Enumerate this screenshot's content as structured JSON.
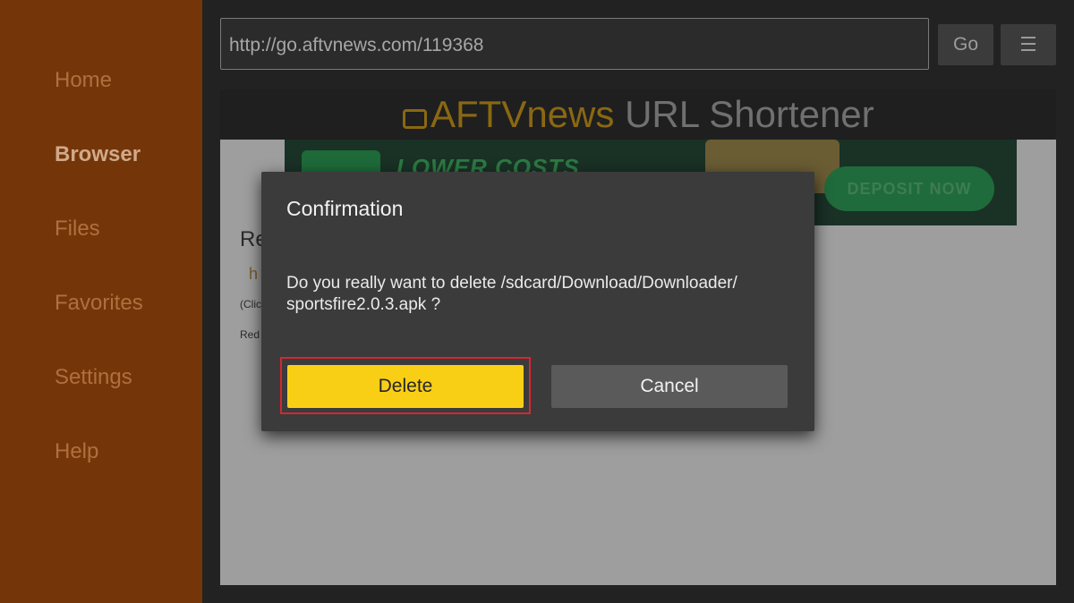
{
  "sidebar": {
    "items": [
      {
        "label": "Home"
      },
      {
        "label": "Browser"
      },
      {
        "label": "Files"
      },
      {
        "label": "Favorites"
      },
      {
        "label": "Settings"
      },
      {
        "label": "Help"
      }
    ],
    "active": "Browser"
  },
  "toolbar": {
    "url_value": "http://go.aftvnews.com/119368",
    "go_label": "Go",
    "menu_icon": "hamburger-icon"
  },
  "webpage": {
    "brand": "AFTVnews",
    "brand_icon": "tv-icon",
    "title_rest": "URL Shortener",
    "ad": {
      "text": "LOWER COSTS",
      "button": "DEPOSIT NOW"
    },
    "fragments": [
      "Re",
      "h",
      "(Clic",
      "Red"
    ]
  },
  "dialog": {
    "title": "Confirmation",
    "message": "Do you really want to delete /sdcard/Download/Downloader/ sportsfire2.0.3.apk ?",
    "delete_label": "Delete",
    "cancel_label": "Cancel"
  },
  "colors": {
    "sidebar": "#743609",
    "accent": "#f9cf16",
    "focus": "#d52731"
  }
}
